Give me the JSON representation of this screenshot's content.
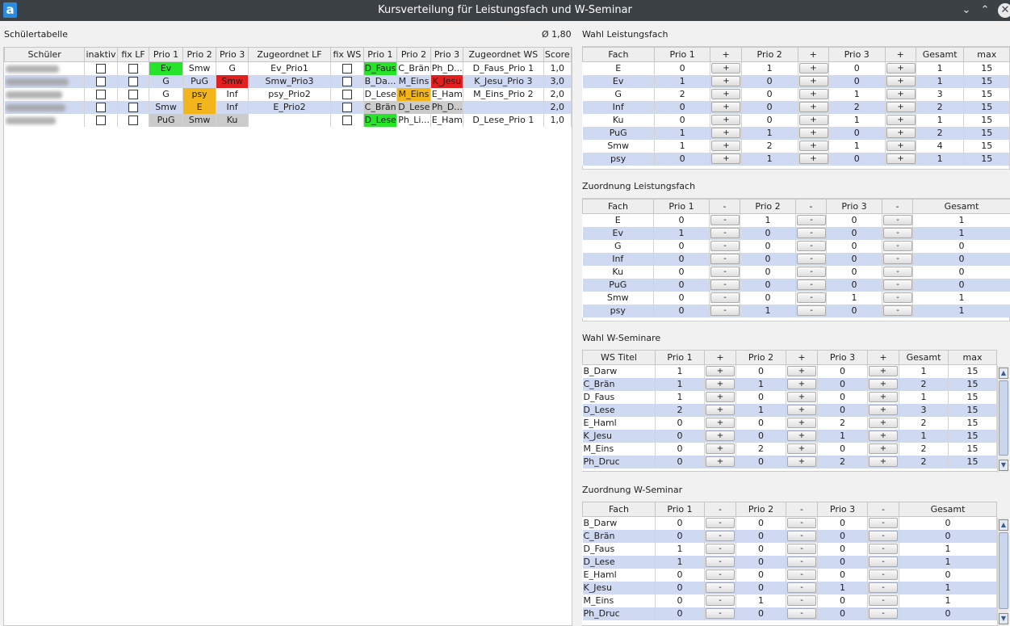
{
  "window": {
    "title": "Kursverteilung für Leistungsfach und W-Seminar",
    "minimize_icon": "chevron-down-icon",
    "maximize_icon": "chevron-up-icon",
    "close_icon": "close-icon",
    "logo_letter": "a"
  },
  "students": {
    "title": "Schülertabelle",
    "average": "Ø 1,80",
    "headers": [
      "Schüler",
      "inaktiv",
      "fix LF",
      "Prio 1",
      "Prio 2",
      "Prio 3",
      "Zugeordnet LF",
      "fix WS",
      "Prio 1",
      "Prio 2",
      "Prio 3",
      "Zugeordnet WS",
      "Score"
    ],
    "rows": [
      {
        "name": "Ar... (blurred)",
        "inaktiv": false,
        "fix_lf": false,
        "p1": "Ev",
        "p2": "Smw",
        "p3": "G",
        "lf": "Ev_Prio1",
        "fix_ws": false,
        "w1": "D_Faus",
        "w2": "C_Brän",
        "w3": "Ph_D...",
        "ws": "D_Faus_Prio 1",
        "score": "1,0"
      },
      {
        "name": "A... (blurred)",
        "inaktiv": false,
        "fix_lf": false,
        "p1": "G",
        "p2": "PuG",
        "p3": "Smw",
        "lf": "Smw_Prio3",
        "fix_ws": false,
        "w1": "B_Da...",
        "w2": "M_Eins",
        "w3": "K_Jesu",
        "ws": "K_Jesu_Prio 3",
        "score": "3,0"
      },
      {
        "name": "A... (blurred)",
        "inaktiv": false,
        "fix_lf": false,
        "p1": "G",
        "p2": "psy",
        "p3": "Inf",
        "lf": "psy_Prio2",
        "fix_ws": false,
        "w1": "D_Lese",
        "w2": "M_Eins",
        "w3": "E_Haml",
        "ws": "M_Eins_Prio 2",
        "score": "2,0"
      },
      {
        "name": "... (blurred)",
        "inaktiv": false,
        "fix_lf": false,
        "p1": "Smw",
        "p2": "E",
        "p3": "Inf",
        "lf": "E_Prio2",
        "fix_ws": false,
        "w1": "C_Brän",
        "w2": "D_Lese",
        "w3": "Ph_D...",
        "ws": "",
        "score": "2,0"
      },
      {
        "name": "... (blurred)",
        "inaktiv": false,
        "fix_lf": false,
        "p1": "PuG",
        "p2": "Smw",
        "p3": "Ku",
        "lf": "",
        "fix_ws": false,
        "w1": "D_Lese",
        "w2": "Ph_Li...",
        "w3": "E_Haml",
        "ws": "D_Lese_Prio 1",
        "score": "1,0"
      }
    ]
  },
  "wahl_lf": {
    "title": "Wahl Leistungsfach",
    "headers": [
      "Fach",
      "Prio 1",
      "+",
      "Prio 2",
      "+",
      "Prio 3",
      "+",
      "Gesamt",
      "max"
    ],
    "button": "+",
    "rows": [
      {
        "fach": "E",
        "p1": "0",
        "p2": "1",
        "p3": "0",
        "ges": "1",
        "max": "15"
      },
      {
        "fach": "Ev",
        "p1": "1",
        "p2": "0",
        "p3": "0",
        "ges": "1",
        "max": "15"
      },
      {
        "fach": "G",
        "p1": "2",
        "p2": "0",
        "p3": "1",
        "ges": "3",
        "max": "15"
      },
      {
        "fach": "Inf",
        "p1": "0",
        "p2": "0",
        "p3": "2",
        "ges": "2",
        "max": "15"
      },
      {
        "fach": "Ku",
        "p1": "0",
        "p2": "0",
        "p3": "1",
        "ges": "1",
        "max": "15"
      },
      {
        "fach": "PuG",
        "p1": "1",
        "p2": "1",
        "p3": "0",
        "ges": "2",
        "max": "15"
      },
      {
        "fach": "Smw",
        "p1": "1",
        "p2": "2",
        "p3": "1",
        "ges": "4",
        "max": "15"
      },
      {
        "fach": "psy",
        "p1": "0",
        "p2": "1",
        "p3": "0",
        "ges": "1",
        "max": "15"
      }
    ]
  },
  "zuord_lf": {
    "title": "Zuordnung Leistungsfach",
    "headers": [
      "Fach",
      "Prio 1",
      "-",
      "Prio 2",
      "-",
      "Prio 3",
      "-",
      "Gesamt"
    ],
    "button": "-",
    "rows": [
      {
        "fach": "E",
        "p1": "0",
        "p2": "1",
        "p3": "0",
        "ges": "1"
      },
      {
        "fach": "Ev",
        "p1": "1",
        "p2": "0",
        "p3": "0",
        "ges": "1"
      },
      {
        "fach": "G",
        "p1": "0",
        "p2": "0",
        "p3": "0",
        "ges": "0"
      },
      {
        "fach": "Inf",
        "p1": "0",
        "p2": "0",
        "p3": "0",
        "ges": "0"
      },
      {
        "fach": "Ku",
        "p1": "0",
        "p2": "0",
        "p3": "0",
        "ges": "0"
      },
      {
        "fach": "PuG",
        "p1": "0",
        "p2": "0",
        "p3": "0",
        "ges": "0"
      },
      {
        "fach": "Smw",
        "p1": "0",
        "p2": "0",
        "p3": "1",
        "ges": "1"
      },
      {
        "fach": "psy",
        "p1": "0",
        "p2": "1",
        "p3": "0",
        "ges": "1"
      }
    ]
  },
  "wahl_ws": {
    "title": "Wahl W-Seminare",
    "headers": [
      "WS Titel",
      "Prio 1",
      "+",
      "Prio 2",
      "+",
      "Prio 3",
      "+",
      "Gesamt",
      "max"
    ],
    "button": "+",
    "rows": [
      {
        "fach": "B_Darw",
        "p1": "1",
        "p2": "0",
        "p3": "0",
        "ges": "1",
        "max": "15"
      },
      {
        "fach": "C_Brän",
        "p1": "1",
        "p2": "1",
        "p3": "0",
        "ges": "2",
        "max": "15"
      },
      {
        "fach": "D_Faus",
        "p1": "1",
        "p2": "0",
        "p3": "0",
        "ges": "1",
        "max": "15"
      },
      {
        "fach": "D_Lese",
        "p1": "2",
        "p2": "1",
        "p3": "0",
        "ges": "3",
        "max": "15"
      },
      {
        "fach": "E_Haml",
        "p1": "0",
        "p2": "0",
        "p3": "2",
        "ges": "2",
        "max": "15"
      },
      {
        "fach": "K_Jesu",
        "p1": "0",
        "p2": "0",
        "p3": "1",
        "ges": "1",
        "max": "15"
      },
      {
        "fach": "M_Eins",
        "p1": "0",
        "p2": "2",
        "p3": "0",
        "ges": "2",
        "max": "15"
      },
      {
        "fach": "Ph_Druc",
        "p1": "0",
        "p2": "0",
        "p3": "2",
        "ges": "2",
        "max": "15"
      }
    ]
  },
  "zuord_ws": {
    "title": "Zuordnung W-Seminar",
    "headers": [
      "Fach",
      "Prio 1",
      "-",
      "Prio 2",
      "-",
      "Prio 3",
      "-",
      "Gesamt"
    ],
    "button": "-",
    "rows": [
      {
        "fach": "B_Darw",
        "p1": "0",
        "p2": "0",
        "p3": "0",
        "ges": "0"
      },
      {
        "fach": "C_Brän",
        "p1": "0",
        "p2": "0",
        "p3": "0",
        "ges": "0"
      },
      {
        "fach": "D_Faus",
        "p1": "1",
        "p2": "0",
        "p3": "0",
        "ges": "1"
      },
      {
        "fach": "D_Lese",
        "p1": "1",
        "p2": "0",
        "p3": "0",
        "ges": "1"
      },
      {
        "fach": "E_Haml",
        "p1": "0",
        "p2": "0",
        "p3": "0",
        "ges": "0"
      },
      {
        "fach": "K_Jesu",
        "p1": "0",
        "p2": "0",
        "p3": "1",
        "ges": "1"
      },
      {
        "fach": "M_Eins",
        "p1": "0",
        "p2": "1",
        "p3": "0",
        "ges": "1"
      },
      {
        "fach": "Ph_Druc",
        "p1": "0",
        "p2": "0",
        "p3": "0",
        "ges": "0"
      }
    ]
  },
  "scroll": {
    "up_icon": "chevron-up-icon",
    "down_icon": "chevron-down-icon"
  }
}
